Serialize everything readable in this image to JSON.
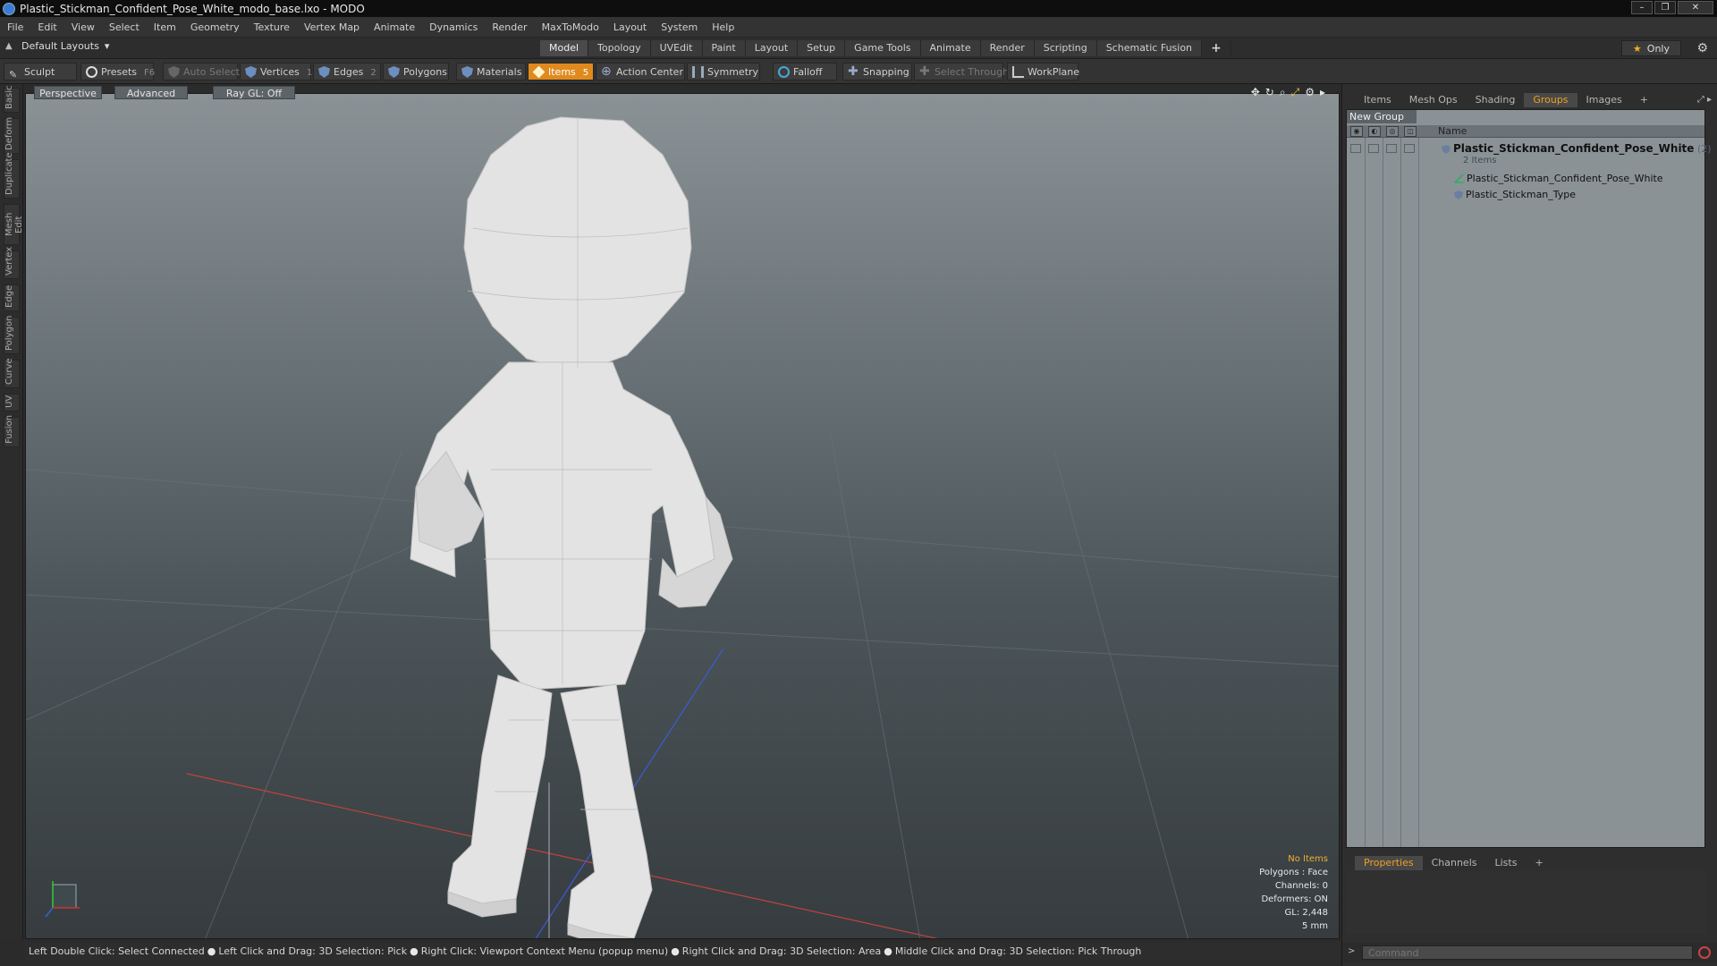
{
  "window": {
    "title": "Plastic_Stickman_Confident_Pose_White_modo_base.lxo - MODO"
  },
  "menu": [
    "File",
    "Edit",
    "View",
    "Select",
    "Item",
    "Geometry",
    "Texture",
    "Vertex Map",
    "Animate",
    "Dynamics",
    "Render",
    "MaxToModo",
    "Layout",
    "System",
    "Help"
  ],
  "layoutbar": {
    "layout_dropdown": "Default Layouts",
    "tabs": [
      "Model",
      "Topology",
      "UVEdit",
      "Paint",
      "Layout",
      "Setup",
      "Game Tools",
      "Animate",
      "Render",
      "Scripting",
      "Schematic Fusion"
    ],
    "active_tab": "Model",
    "only_label": "Only"
  },
  "toolbar": {
    "sculpt": "Sculpt",
    "presets": "Presets",
    "presets_key": "F6",
    "auto_select": "Auto Select",
    "vertices": "Vertices",
    "vertices_key": "1",
    "edges": "Edges",
    "edges_key": "2",
    "polygons": "Polygons",
    "materials": "Materials",
    "items": "Items",
    "items_key": "5",
    "action_center": "Action Center",
    "symmetry": "Symmetry",
    "falloff": "Falloff",
    "snapping": "Snapping",
    "select_through": "Select Through",
    "workplane": "WorkPlane"
  },
  "left_tabs": [
    "Basic",
    "Deform",
    "Duplicate",
    "Mesh Edit",
    "Vertex",
    "Edge",
    "Polygon",
    "Curve",
    "UV",
    "Fusion"
  ],
  "viewport": {
    "view_mode": "Perspective",
    "shading": "Advanced",
    "raygl": "Ray GL: Off",
    "info": {
      "selection": "No Items",
      "polygons": "Polygons : Face",
      "channels": "Channels: 0",
      "deformers": "Deformers: ON",
      "gl": "GL: 2,448",
      "grid": "5 mm"
    }
  },
  "statusbar": {
    "items": [
      "Left Double Click: Select Connected",
      "Left Click and Drag: 3D Selection: Pick",
      "Right Click: Viewport Context Menu (popup menu)",
      "Right Click and Drag: 3D Selection: Area",
      "Middle Click and Drag: 3D Selection: Pick Through"
    ]
  },
  "right_panel": {
    "tabs": [
      "Items",
      "Mesh Ops",
      "Shading",
      "Groups",
      "Images"
    ],
    "active_tab": "Groups",
    "new_group": "New Group",
    "name_header": "Name",
    "group": {
      "name": "Plastic_Stickman_Confident_Pose_White",
      "count": "(2)",
      "subtitle": "2 Items",
      "children": [
        "Plastic_Stickman_Confident_Pose_White",
        "Plastic_Stickman_Type"
      ]
    },
    "lower_tabs": [
      "Properties",
      "Channels",
      "Lists"
    ],
    "lower_active": "Properties",
    "command_placeholder": "Command"
  },
  "colors": {
    "accent_orange": "#e08a1e",
    "active_tab_text": "#f0a020",
    "info_accent": "#f0b030"
  }
}
